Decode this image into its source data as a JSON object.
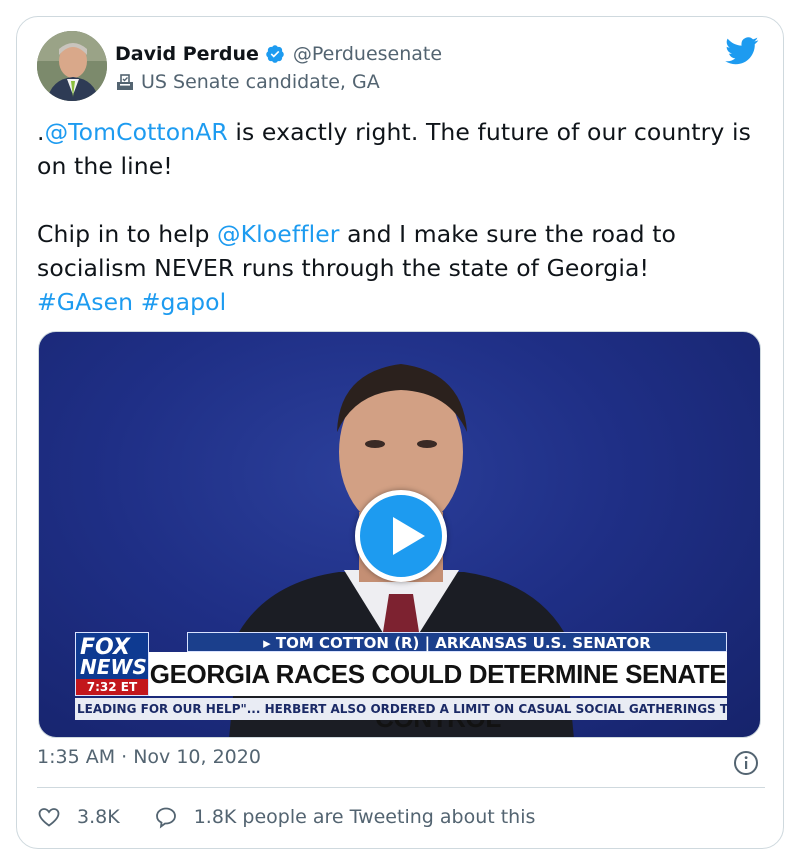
{
  "author": {
    "name": "David Perdue",
    "handle": "@Perduesenate",
    "label": "US Senate candidate, GA"
  },
  "tweet": {
    "line1_prefix": ".",
    "mention1": "@TomCottonAR",
    "line1_rest": " is exactly right. The future of our country is on the line!",
    "line2_prefix": "Chip in to help ",
    "mention2": "@Kloeffler",
    "line2_rest": " and I make sure the road to socialism NEVER runs through the state of Georgia!",
    "hashtag1": "#GAsen",
    "hashtag2": "#gapol"
  },
  "video": {
    "nameplate": "▸ TOM COTTON (R) | ARKANSAS U.S. SENATOR",
    "headline": "GEORGIA RACES COULD DETERMINE SENATE CONTROL",
    "logo_top": "FOX",
    "logo_bottom": "NEWS",
    "clock": "7:32 ET",
    "ticker": "LEADING FOR OUR HELP\"...  HERBERT ALSO ORDERED A LIMIT ON CASUAL SOCIAL GATHERINGS TO HOUSE"
  },
  "meta": {
    "timestamp": "1:35 AM · Nov 10, 2020"
  },
  "actions": {
    "likes": "3.8K",
    "replies_text": "1.8K people are Tweeting about this"
  },
  "colors": {
    "link": "#1d9bf0",
    "text": "#0f1419",
    "muted": "#536471",
    "border": "#cfd9de"
  },
  "icons": [
    "verified-badge-icon",
    "ballot-box-icon",
    "twitter-bird-icon",
    "play-icon",
    "info-icon",
    "heart-icon",
    "speech-bubble-icon"
  ]
}
